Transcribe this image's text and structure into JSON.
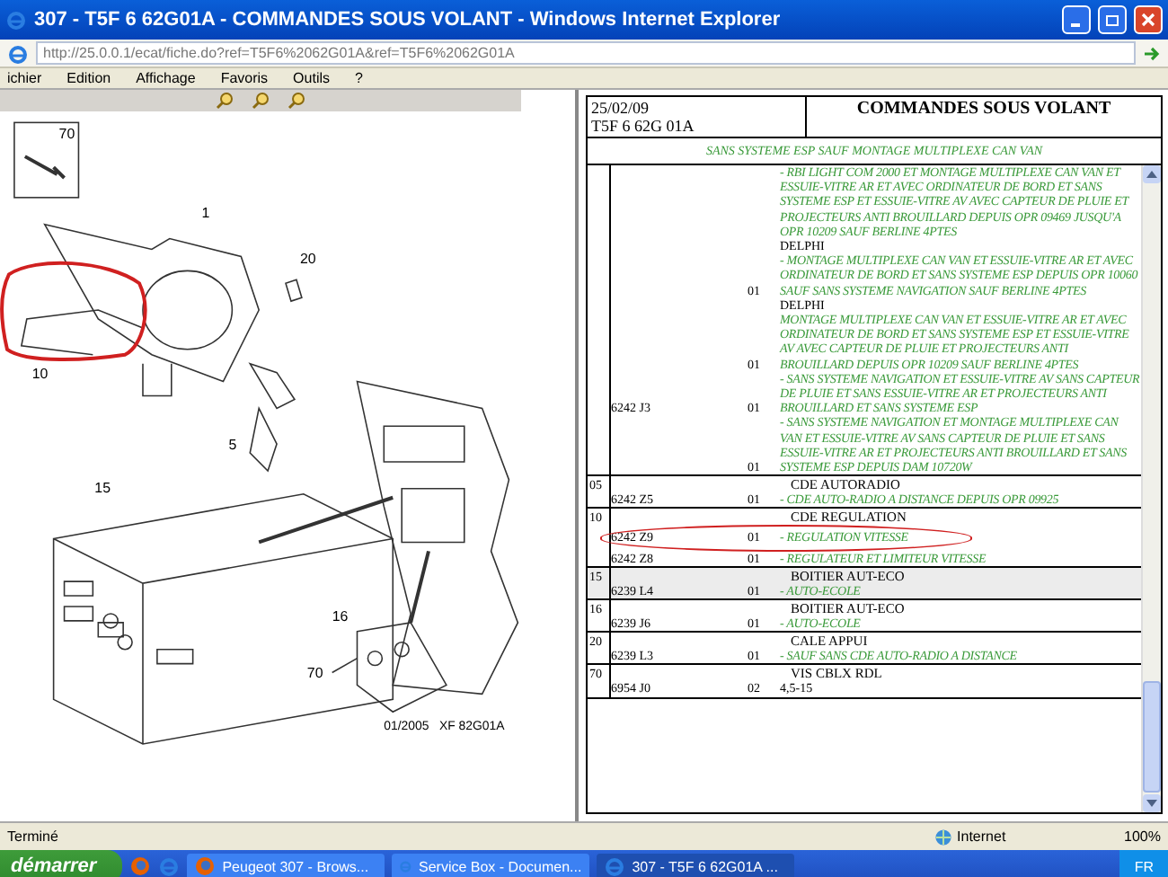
{
  "window": {
    "title": "307 - T5F 6 62G01A - COMMANDES SOUS VOLANT - Windows Internet Explorer"
  },
  "address_bar": {
    "value": "http://25.0.0.1/ecat/fiche.do?ref=T5F6%2062G01A&ref=T5F6%2062G01A"
  },
  "menu": [
    "ichier",
    "Edition",
    "Affichage",
    "Favoris",
    "Outils",
    "?"
  ],
  "diagram": {
    "labels": [
      "70",
      "1",
      "20",
      "10",
      "5",
      "15",
      "16",
      "70"
    ],
    "caption": "01/2005   XF 82G01A"
  },
  "sheet": {
    "date": "25/02/09",
    "reference": "T5F 6 62G 01A",
    "title": "COMMANDES SOUS VOLANT",
    "condition": "SANS SYSTEME ESP SAUF MONTAGE MULTIPLEXE CAN VAN"
  },
  "groups": [
    {
      "selected": false,
      "parts": [
        {
          "note": "- RBI LIGHT COM 2000 ET MONTAGE MULTIPLEXE CAN VAN ET ESSUIE-VITRE AR ET AVEC ORDINATEUR DE BORD ET SANS SYSTEME ESP ET ESSUIE-VITRE AV AVEC CAPTEUR DE PLUIE ET PROJECTEURS ANTI BROUILLARD DEPUIS OPR 09469 JUSQU'A OPR 10209 SAUF BERLINE 4PTES",
          "circled": false
        },
        {
          "qty": "01",
          "name": "DELPHI",
          "note": "- MONTAGE MULTIPLEXE CAN VAN ET ESSUIE-VITRE AR ET AVEC ORDINATEUR DE BORD ET SANS SYSTEME ESP DEPUIS OPR 10060 SAUF SANS SYSTEME NAVIGATION SAUF BERLINE 4PTES",
          "circled": false
        },
        {
          "qty": "01",
          "name": "DELPHI",
          "note": "MONTAGE MULTIPLEXE CAN VAN ET ESSUIE-VITRE AR ET AVEC ORDINATEUR DE BORD ET SANS SYSTEME ESP ET ESSUIE-VITRE AV AVEC CAPTEUR DE PLUIE ET PROJECTEURS ANTI BROUILLARD DEPUIS OPR 10209 SAUF BERLINE 4PTES",
          "circled": false
        },
        {
          "ref": "6242 J3",
          "qty": "01",
          "note": "- SANS SYSTEME NAVIGATION ET ESSUIE-VITRE AV SANS CAPTEUR DE PLUIE ET SANS ESSUIE-VITRE AR ET PROJECTEURS ANTI BROUILLARD ET SANS SYSTEME ESP",
          "circled": false
        },
        {
          "qty": "01",
          "note": "- SANS SYSTEME NAVIGATION ET MONTAGE MULTIPLEXE CAN VAN ET ESSUIE-VITRE AV SANS CAPTEUR DE PLUIE ET SANS ESSUIE-VITRE AR ET PROJECTEURS ANTI BROUILLARD ET SANS SYSTEME ESP DEPUIS DAM 10720W",
          "circled": false
        }
      ]
    },
    {
      "number": "05",
      "title": "CDE AUTORADIO",
      "selected": false,
      "parts": [
        {
          "ref": "6242 Z5",
          "qty": "01",
          "note": "- CDE AUTO-RADIO A DISTANCE DEPUIS OPR 09925",
          "circled": false
        }
      ]
    },
    {
      "number": "10",
      "title": "CDE REGULATION",
      "selected": false,
      "parts": [
        {
          "ref": "6242 Z9",
          "qty": "01",
          "note": "- REGULATION VITESSE",
          "circled": true
        },
        {
          "ref": "6242 Z8",
          "qty": "01",
          "note": "- REGULATEUR ET LIMITEUR VITESSE",
          "circled": false
        }
      ]
    },
    {
      "number": "15",
      "title": "BOITIER AUT-ECO",
      "selected": true,
      "parts": [
        {
          "ref": "6239 L4",
          "qty": "01",
          "note": "- AUTO-ECOLE",
          "circled": false
        }
      ]
    },
    {
      "number": "16",
      "title": "BOITIER AUT-ECO",
      "selected": false,
      "parts": [
        {
          "ref": "6239 J6",
          "qty": "01",
          "note": "- AUTO-ECOLE",
          "circled": false
        }
      ]
    },
    {
      "number": "20",
      "title": "CALE APPUI",
      "selected": false,
      "parts": [
        {
          "ref": "6239 L3",
          "qty": "01",
          "note": "- SAUF SANS CDE AUTO-RADIO A DISTANCE",
          "circled": false
        }
      ]
    },
    {
      "number": "70",
      "title": "VIS CBLX RDL",
      "selected": false,
      "parts": [
        {
          "ref": "6954 J0",
          "qty": "02",
          "plain": "4,5-15",
          "circled": false
        }
      ]
    }
  ],
  "status_bar": {
    "text": "Terminé",
    "zone": "Internet",
    "zoom": "100%"
  },
  "taskbar": {
    "start": "démarrer",
    "tasks": [
      {
        "label": "Peugeot 307 - Brows...",
        "kind": "firefox",
        "selected": false
      },
      {
        "label": "Service Box - Documen...",
        "kind": "ie",
        "selected": false
      },
      {
        "label": "307 - T5F 6 62G01A ...",
        "kind": "ie",
        "selected": true
      }
    ],
    "language": "FR"
  }
}
